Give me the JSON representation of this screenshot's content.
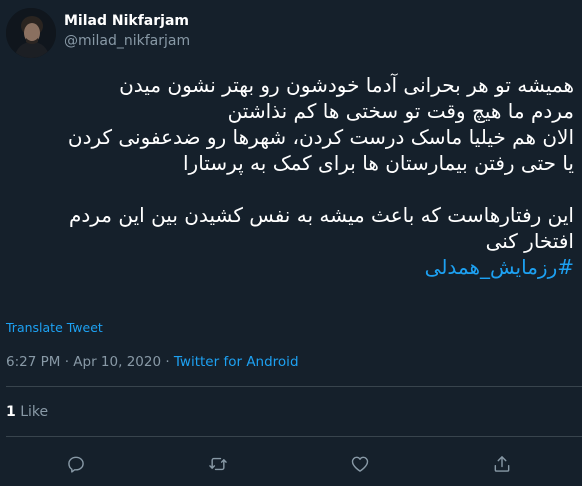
{
  "author": {
    "name": "Milad Nikfarjam",
    "handle": "@milad_nikfarjam"
  },
  "tweet": {
    "lines": [
      "همیشه تو هر بحرانی آدما خودشون رو بهتر نشون میدن",
      "مردم ما هیچ وقت تو سختی ها کم نذاشتن",
      "الان هم خیلیا ماسک درست کردن، شهرها رو ضدعفونی کردن",
      "یا حتی رفتن بیمارستان ها برای کمک به پرستارا",
      "",
      "این رفتارهاست که باعث میشه به نفس کشیدن بین این مردم",
      "افتخار کنی"
    ],
    "hashtag": "#رزمایش_همدلی"
  },
  "translate_label": "Translate Tweet",
  "meta": {
    "time": "6:27 PM",
    "separator1": " · ",
    "date": "Apr 10, 2020",
    "separator2": " · ",
    "source": "Twitter for Android"
  },
  "stats": {
    "likes_count": "1",
    "likes_label": " Like"
  },
  "actions": [
    "reply-icon",
    "retweet-icon",
    "like-icon",
    "share-icon"
  ],
  "colors": {
    "background": "#15202b",
    "accent": "#1da1f2",
    "secondary_text": "#8899a6",
    "divider": "#38444d"
  }
}
